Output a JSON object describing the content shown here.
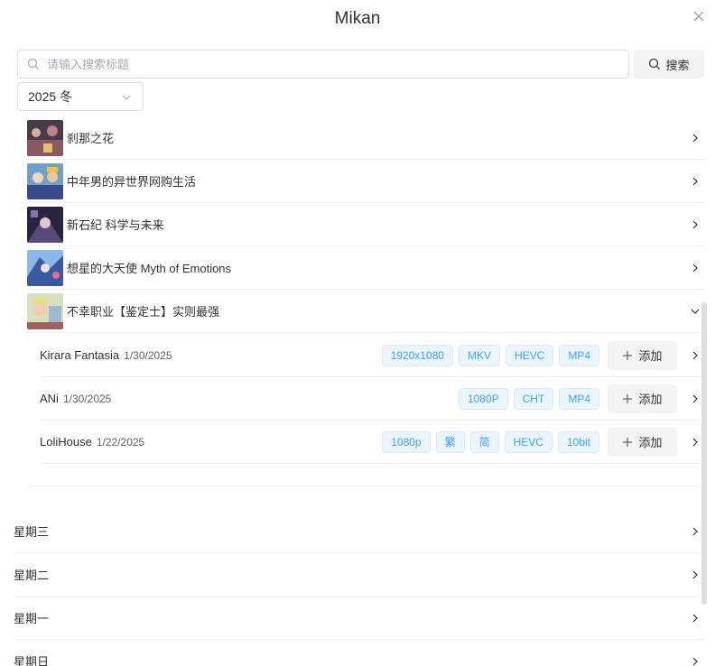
{
  "dialog": {
    "title": "Mikan"
  },
  "search": {
    "placeholder": "请输入搜索标题",
    "value": "",
    "button_label": "搜索"
  },
  "season": {
    "selected": "2025 冬"
  },
  "anime_list": [
    {
      "name": "刹那之花",
      "expanded": false
    },
    {
      "name": "中年男的异世界网购生活",
      "expanded": false
    },
    {
      "name": "新石纪 科学与未来",
      "expanded": false
    },
    {
      "name": "想星的大天使 Myth of Emotions",
      "expanded": false
    },
    {
      "name": "不幸职业【鉴定士】实则最强",
      "expanded": true
    }
  ],
  "resources": [
    {
      "group": "Kirara Fantasia",
      "date": "1/30/2025",
      "tags": [
        "1920x1080",
        "MKV",
        "HEVC",
        "MP4"
      ],
      "add_label": "添加"
    },
    {
      "group": "ANi",
      "date": "1/30/2025",
      "tags": [
        "1080P",
        "CHT",
        "MP4"
      ],
      "add_label": "添加"
    },
    {
      "group": "LoliHouse",
      "date": "1/22/2025",
      "tags": [
        "1080p",
        "繁",
        "简",
        "HEVC",
        "10bit"
      ],
      "add_label": "添加"
    }
  ],
  "weekdays": [
    {
      "name": "星期三"
    },
    {
      "name": "星期二"
    },
    {
      "name": "星期一"
    },
    {
      "name": "星期日"
    }
  ],
  "colors": {
    "tag_text": "#409eff",
    "tag_bg": "#ecf5ff",
    "border": "#ebeef5"
  },
  "icons": {
    "close": "close-icon",
    "search": "search-icon",
    "chevron_down": "chevron-down-icon",
    "chevron_right": "chevron-right-icon",
    "plus": "plus-icon"
  }
}
